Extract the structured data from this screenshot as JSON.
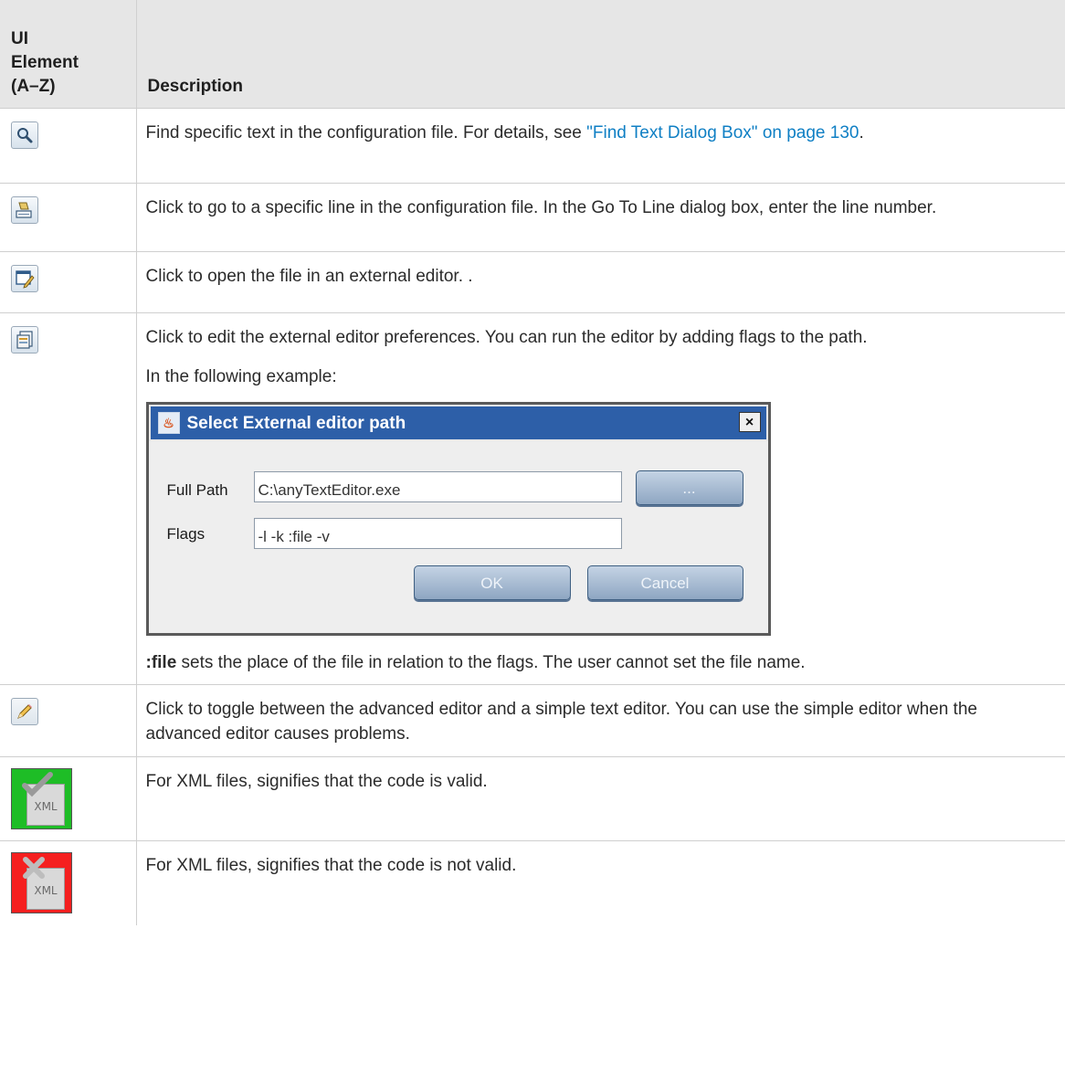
{
  "header": {
    "col1_line1": "UI",
    "col1_line2": "Element",
    "col1_line3": "(A–Z)",
    "col2": "Description"
  },
  "rows": [
    {
      "icon": "find-text-icon",
      "text": "Find specific text in the configuration file. For details, see ",
      "link": "\"Find Text Dialog Box\" on page 130",
      "text_after": "."
    },
    {
      "icon": "go-to-line-icon",
      "text": "Click to go to a specific line in the configuration file. In the Go To Line dialog box, enter the line number."
    },
    {
      "icon": "external-editor-icon",
      "text": "Click to open the file in an external editor. ."
    },
    {
      "icon": "editor-preferences-icon",
      "text": "Click to edit the external editor preferences. You can run the editor by adding flags to the path.",
      "text2": "In the following example:",
      "dialog": {
        "title": "Select External editor path",
        "close": "×",
        "full_path_label": "Full Path",
        "full_path_value": "C:\\anyTextEditor.exe",
        "browse_label": "...",
        "flags_label": "Flags",
        "flags_value": "-l -k :file -v",
        "ok_label": "OK",
        "cancel_label": "Cancel"
      },
      "note_bold": ":file",
      "note_rest": " sets the place of the file in relation to the flags. The user cannot set the file name."
    },
    {
      "icon": "pencil-toggle-icon",
      "text": "Click to toggle between the advanced editor and a simple text editor. You can use the simple editor when the advanced editor causes problems."
    },
    {
      "icon": "xml-valid-icon",
      "badge_text": "XML",
      "text": "For XML files, signifies that the code is valid."
    },
    {
      "icon": "xml-invalid-icon",
      "badge_text": "XML",
      "text": "For XML files, signifies that the code is not valid."
    }
  ]
}
